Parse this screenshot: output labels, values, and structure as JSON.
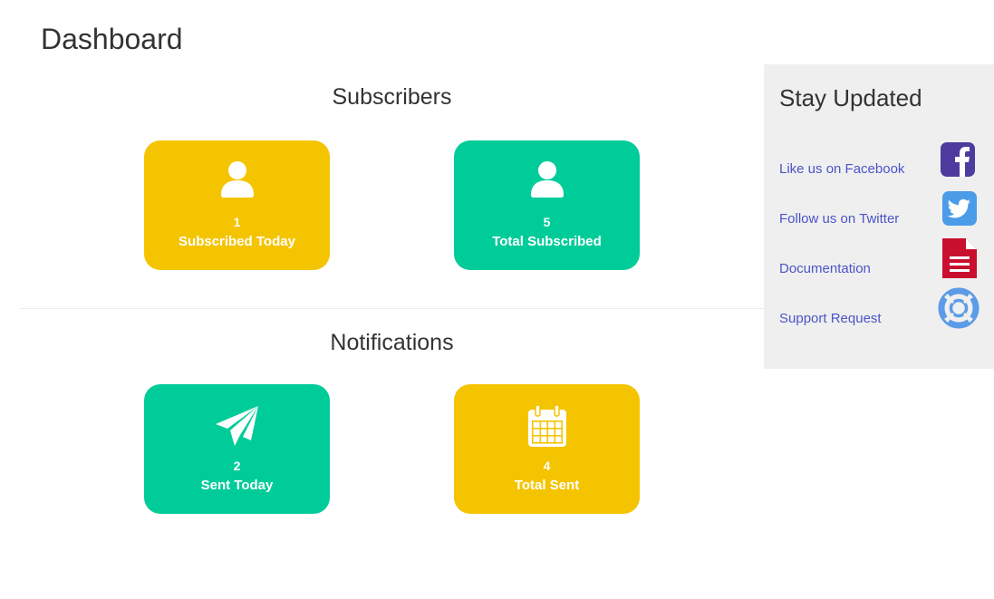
{
  "page": {
    "title": "Dashboard"
  },
  "colors": {
    "yellow": "#f5c400",
    "green": "#00cc99",
    "link": "#4b55c8",
    "sidebar_bg": "#efefef"
  },
  "subscribers": {
    "title": "Subscribers",
    "cards": [
      {
        "count": "1",
        "label": "Subscribed Today",
        "icon": "user-icon",
        "color": "yellow"
      },
      {
        "count": "5",
        "label": "Total Subscribed",
        "icon": "user-icon",
        "color": "green"
      }
    ]
  },
  "notifications": {
    "title": "Notifications",
    "cards": [
      {
        "count": "2",
        "label": "Sent Today",
        "icon": "paper-plane-icon",
        "color": "green"
      },
      {
        "count": "4",
        "label": "Total Sent",
        "icon": "calendar-icon",
        "color": "yellow"
      }
    ]
  },
  "sidebar": {
    "title": "Stay Updated",
    "links": [
      {
        "label": "Like us on Facebook",
        "icon": "facebook-icon"
      },
      {
        "label": "Follow us on Twitter",
        "icon": "twitter-icon"
      },
      {
        "label": "Documentation",
        "icon": "document-icon"
      },
      {
        "label": "Support Request",
        "icon": "lifebuoy-icon"
      }
    ]
  }
}
